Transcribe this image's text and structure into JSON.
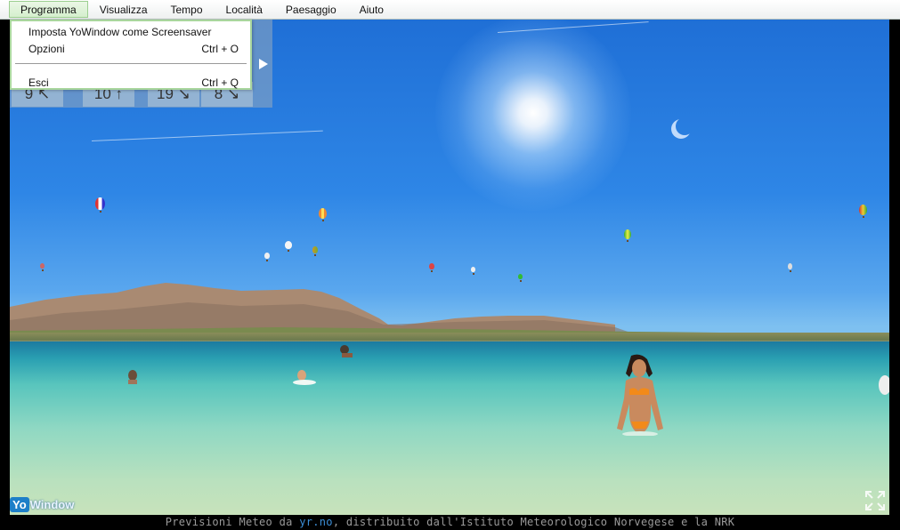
{
  "menu": {
    "items": [
      {
        "label": "Programma"
      },
      {
        "label": "Visualizza"
      },
      {
        "label": "Tempo"
      },
      {
        "label": "Località"
      },
      {
        "label": "Paesaggio"
      },
      {
        "label": "Aiuto"
      }
    ],
    "active_index": 0
  },
  "dropdown": {
    "items": [
      {
        "label": "Imposta YoWindow come Screensaver",
        "shortcut": ""
      },
      {
        "label": "Opzioni",
        "shortcut": "Ctrl + O"
      },
      {
        "label": "Esci",
        "shortcut": "Ctrl + Q"
      }
    ]
  },
  "forecast": {
    "cells": [
      {
        "text": "9 ↖"
      },
      {
        "text": "10 ↑"
      },
      {
        "text": "19 ↘"
      },
      {
        "text": "8 ↘"
      }
    ],
    "next_icon": "play-arrow-icon"
  },
  "logo": {
    "part1": "Yo",
    "part2": "Window"
  },
  "status": {
    "prefix": "Previsioni Meteo da ",
    "link": "yr.no",
    "suffix": ", distribuito dall'Istituto Meteorologico Norvegese e la NRK"
  },
  "icons": {
    "fullscreen": "fullscreen-icon"
  },
  "colors": {
    "menu_active_border": "#9ccf90",
    "dropdown_border": "#a9d69d",
    "link": "#3c8fd8",
    "logo_blue": "#1d7fc8"
  }
}
